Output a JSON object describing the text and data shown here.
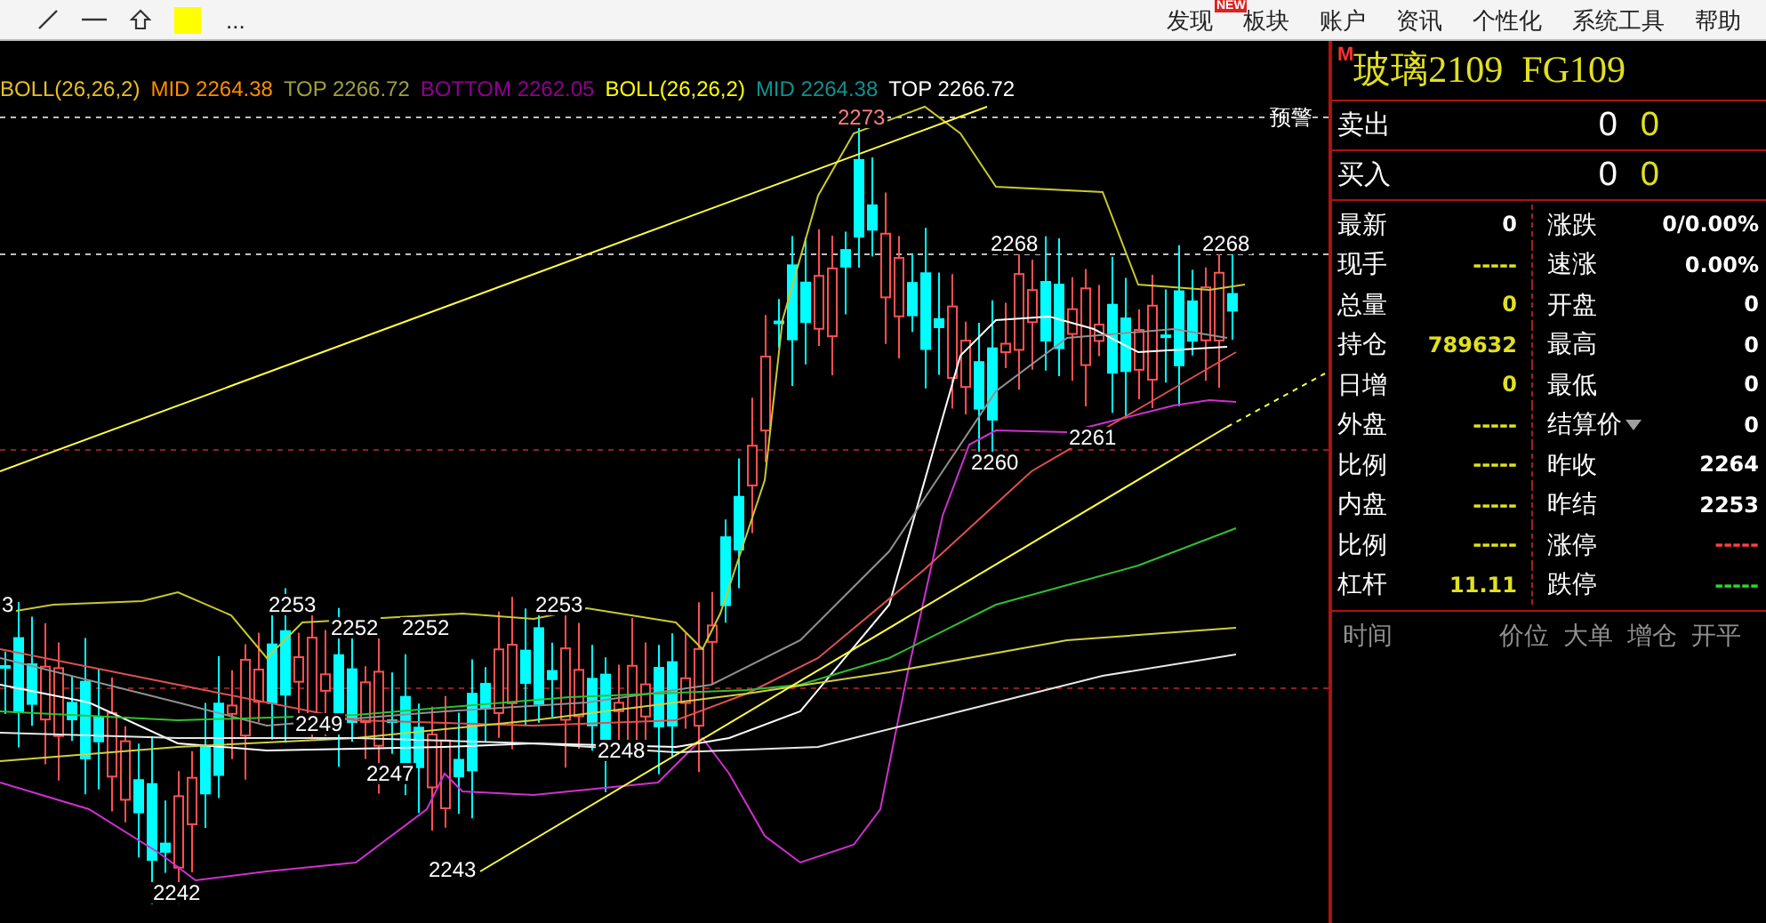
{
  "toolbar": {
    "more": "..."
  },
  "menu": [
    {
      "label": "发现",
      "badge": "NEW"
    },
    {
      "label": "板块"
    },
    {
      "label": "账户"
    },
    {
      "label": "资讯"
    },
    {
      "label": "个性化"
    },
    {
      "label": "系统工具"
    },
    {
      "label": "帮助"
    }
  ],
  "legend": [
    {
      "text": "BOLL(26,26,2)",
      "color": "#e8c020"
    },
    {
      "text": "MID 2264.38",
      "color": "#ff8c00"
    },
    {
      "text": "TOP 2266.72",
      "color": "#a0a040"
    },
    {
      "text": "BOTTOM 2262.05",
      "color": "#900090"
    },
    {
      "text": "BOLL(26,26,2)",
      "color": "#ffff00"
    },
    {
      "text": "MID 2264.38",
      "color": "#109090"
    },
    {
      "text": "TOP 2266.72",
      "color": "#ffffff"
    }
  ],
  "chart": {
    "alert_label": "预警",
    "price_labels": [
      {
        "text": "2273",
        "color": "#ff8080"
      },
      {
        "text": "2268",
        "color": "#ffffff"
      },
      {
        "text": "2268",
        "color": "#ffffff"
      },
      {
        "text": "2260",
        "color": "#ffffff"
      },
      {
        "text": "2261",
        "color": "#ffffff"
      },
      {
        "text": "3",
        "color": "#ffffff"
      },
      {
        "text": "2253",
        "color": "#ffffff"
      },
      {
        "text": "2252",
        "color": "#ffffff"
      },
      {
        "text": "2252",
        "color": "#ffffff"
      },
      {
        "text": "2253",
        "color": "#ffffff"
      },
      {
        "text": "2249",
        "color": "#ffffff"
      },
      {
        "text": "2247",
        "color": "#ffffff"
      },
      {
        "text": "2248",
        "color": "#ffffff"
      },
      {
        "text": "2243",
        "color": "#ffffff"
      },
      {
        "text": "2242",
        "color": "#ffffff"
      }
    ]
  },
  "quote": {
    "marker": "M",
    "title": "玻璃2109  FG109",
    "sell": {
      "label": "卖出",
      "price": "0",
      "volume": "0"
    },
    "buy": {
      "label": "买入",
      "price": "0",
      "volume": "0"
    },
    "rows": [
      {
        "left": {
          "label": "最新",
          "value": "0",
          "color": "#ffffff"
        },
        "right": {
          "label": "涨跌",
          "value": "0/0.00%",
          "color": "#ffffff"
        }
      },
      {
        "left": {
          "label": "现手",
          "value": "-----",
          "color": "#e0e020"
        },
        "right": {
          "label": "速涨",
          "value": "0.00%",
          "color": "#ffffff"
        }
      },
      {
        "left": {
          "label": "总量",
          "value": "0",
          "color": "#e0e020"
        },
        "right": {
          "label": "开盘",
          "value": "0",
          "color": "#ffffff"
        }
      },
      {
        "left": {
          "label": "持仓",
          "value": "789632",
          "color": "#e0e020"
        },
        "right": {
          "label": "最高",
          "value": "0",
          "color": "#ffffff"
        }
      },
      {
        "left": {
          "label": "日增",
          "value": "0",
          "color": "#e0e020"
        },
        "right": {
          "label": "最低",
          "value": "0",
          "color": "#ffffff"
        }
      },
      {
        "left": {
          "label": "外盘",
          "value": "-----",
          "color": "#e0e020"
        },
        "right": {
          "label": "结算价",
          "value": "0",
          "color": "#ffffff",
          "dropdown": true
        }
      },
      {
        "left": {
          "label": "比例",
          "value": "-----",
          "color": "#e0e020"
        },
        "right": {
          "label": "昨收",
          "value": "2264",
          "color": "#ffffff"
        }
      },
      {
        "left": {
          "label": "内盘",
          "value": "-----",
          "color": "#e0e020"
        },
        "right": {
          "label": "昨结",
          "value": "2253",
          "color": "#ffffff"
        }
      },
      {
        "left": {
          "label": "比例",
          "value": "-----",
          "color": "#e0e020"
        },
        "right": {
          "label": "涨停",
          "value": "-----",
          "color": "#ff4040"
        }
      },
      {
        "left": {
          "label": "杠杆",
          "value": "11.11",
          "color": "#e0e020"
        },
        "right": {
          "label": "跌停",
          "value": "-----",
          "color": "#20e020"
        }
      }
    ],
    "trades_header": [
      "时间",
      "价位",
      "大单",
      "增仓",
      "开平"
    ]
  }
}
